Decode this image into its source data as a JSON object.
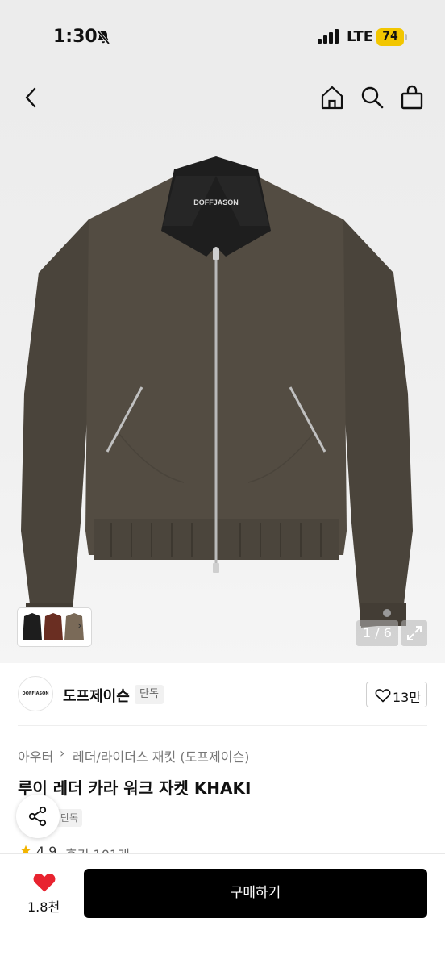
{
  "status_bar": {
    "time": "1:30",
    "network": "LTE",
    "battery": "74",
    "battery_color": "#f2c600",
    "icons": [
      "bell-slash-icon",
      "signal-bars-icon"
    ]
  },
  "nav": {
    "icons": [
      "chevron-left-icon",
      "home-icon",
      "search-icon",
      "shopping-bag-icon"
    ]
  },
  "hero": {
    "image": "khaki-leather-collar-work-jacket",
    "jacket_label": "DOFFJASON",
    "page_counter": "1 / 6",
    "icons": [
      "expand-icon",
      "chevron-right-icon"
    ]
  },
  "brand": {
    "logo_text": "DOFFJASON",
    "name": "도프제이슨",
    "badge": "단독",
    "like_count": "13만",
    "like_icon": "heart-outline-icon"
  },
  "product": {
    "breadcrumb": [
      "아우터",
      "레더/라이더스 재킷 (도프제이슨)"
    ],
    "title": "루이 레더 카라 워크 자켓 KHAKI",
    "badge": "단독",
    "rating": "4.9",
    "reviews": "후기 101개",
    "share_icon": "share-icon"
  },
  "bottom_bar": {
    "wish_count": "1.8천",
    "wish_color": "#e8232f",
    "buy_label": "구매하기"
  }
}
